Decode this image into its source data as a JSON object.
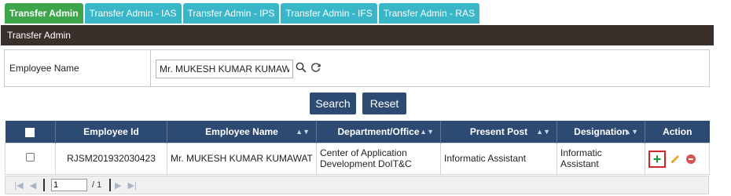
{
  "tabs": [
    {
      "label": "Transfer Admin",
      "active": true
    },
    {
      "label": "Transfer Admin - IAS",
      "active": false
    },
    {
      "label": "Transfer Admin - IPS",
      "active": false
    },
    {
      "label": "Transfer Admin - IFS",
      "active": false
    },
    {
      "label": "Transfer Admin - RAS",
      "active": false
    }
  ],
  "panel_title": "Transfer Admin",
  "filter": {
    "label": "Employee Name",
    "value": "Mr. MUKESH KUMAR KUMAWAT",
    "search_icon": "search-icon",
    "refresh_icon": "refresh-icon"
  },
  "buttons": {
    "search": "Search",
    "reset": "Reset"
  },
  "table": {
    "columns": [
      "",
      "Employee Id",
      "Employee Name",
      "Department/Office",
      "Present Post",
      "Designation",
      "Action"
    ],
    "rows": [
      {
        "employee_id": "RJSM201932030423",
        "employee_name": "Mr. MUKESH KUMAR KUMAWAT",
        "department": "Center of Application Development DoIT&C",
        "present_post": "Informatic Assistant",
        "designation": "Informatic Assistant",
        "actions": [
          "add-icon",
          "edit-icon",
          "delete-icon"
        ]
      }
    ]
  },
  "pager": {
    "page": "1",
    "total": "/ 1"
  },
  "colors": {
    "tab_active": "#3fa54a",
    "tab_inactive": "#39b7c8",
    "header": "#2c4a72",
    "panel": "#3a302b",
    "highlight": "#d2262f"
  }
}
